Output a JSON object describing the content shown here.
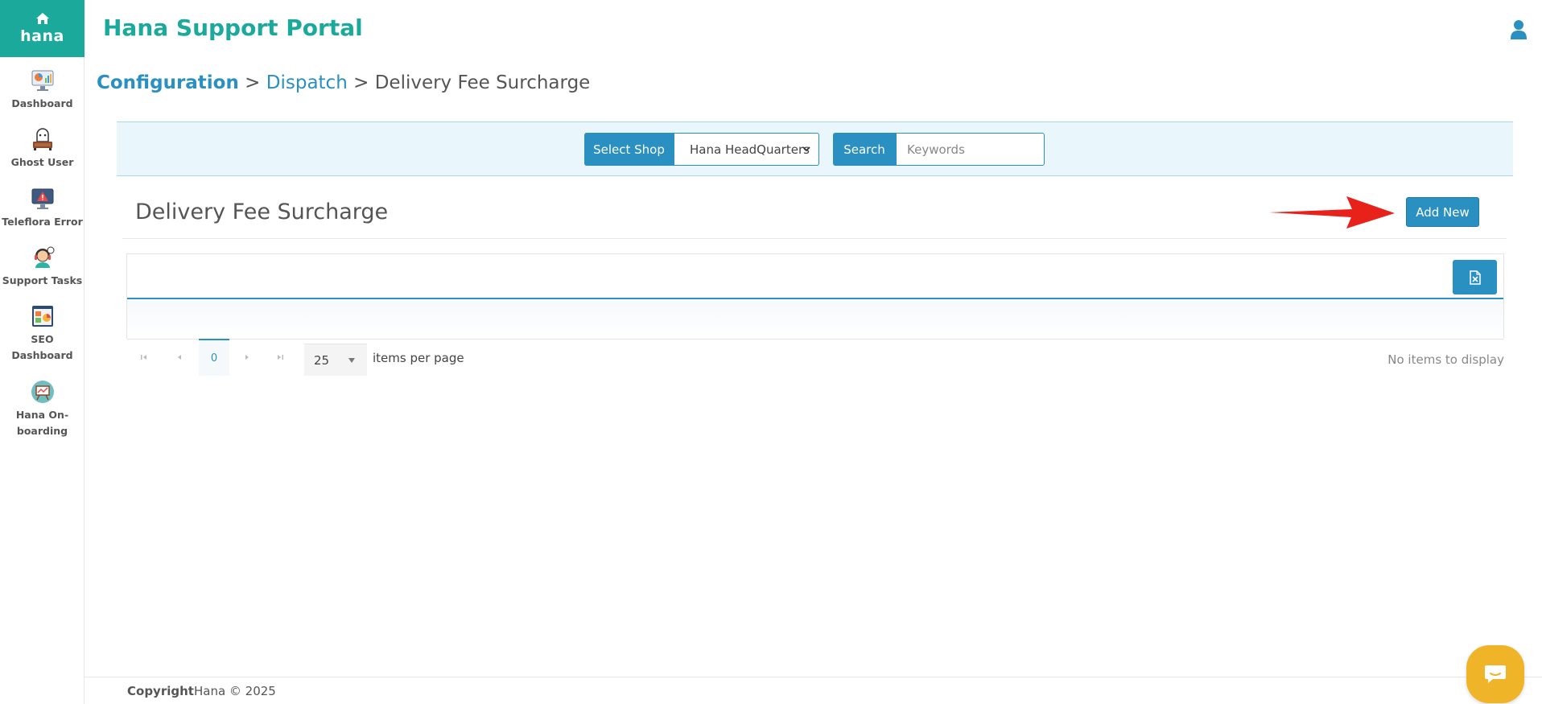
{
  "app": {
    "brand_word": "hana",
    "portal_title": "Hana Support Portal"
  },
  "sidebar": {
    "items": [
      {
        "label": "Dashboard",
        "icon": "dashboard-icon"
      },
      {
        "label": "Ghost User",
        "icon": "ghost-user-icon"
      },
      {
        "label": "Teleflora Error",
        "icon": "warning-monitor-icon"
      },
      {
        "label": "Support Tasks",
        "icon": "support-agent-icon"
      },
      {
        "label": "SEO Dashboard",
        "icon": "seo-icon"
      },
      {
        "label": "Hana On-boarding",
        "icon": "onboarding-board-icon"
      }
    ]
  },
  "breadcrumb": {
    "part1": "Configuration",
    "sep1": " > ",
    "part2": "Dispatch",
    "sep2": " > ",
    "part3": "Delivery Fee Surcharge"
  },
  "filters": {
    "shop_label": "Select Shop",
    "shop_value": "Hana HeadQuarters",
    "search_label": "Search",
    "search_placeholder": "Keywords"
  },
  "section": {
    "title": "Delivery Fee Surcharge",
    "add_new_label": "Add New"
  },
  "pager": {
    "current_page": "0",
    "page_size": "25",
    "items_per_page_label": "items per page",
    "info": "No items to display"
  },
  "footer": {
    "copyright_bold": "Copyright",
    "copyright_text": "Hana © 2025"
  },
  "colors": {
    "brand": "#1aa99a",
    "primary": "#2a8fc1",
    "chat": "#f0b429",
    "arrow": "#e8211b"
  }
}
